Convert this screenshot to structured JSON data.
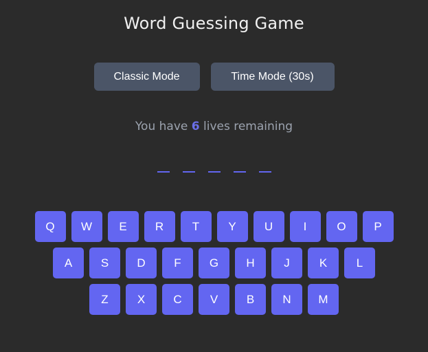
{
  "title": "Word Guessing Game",
  "modes": {
    "classic_label": "Classic Mode",
    "time_label": "Time Mode (30s)"
  },
  "lives": {
    "prefix": "You have",
    "count": "6",
    "suffix": "lives remaining"
  },
  "word": {
    "slots": [
      "_",
      "_",
      "_",
      "_",
      "_"
    ]
  },
  "keyboard": {
    "rows": [
      [
        "Q",
        "W",
        "E",
        "R",
        "T",
        "Y",
        "U",
        "I",
        "O",
        "P"
      ],
      [
        "A",
        "S",
        "D",
        "F",
        "G",
        "H",
        "J",
        "K",
        "L"
      ],
      [
        "Z",
        "X",
        "C",
        "V",
        "B",
        "N",
        "M"
      ]
    ]
  },
  "colors": {
    "background": "#2b2b2b",
    "key": "#6366f1",
    "mode_button": "#4b5567",
    "lives_count": "#6b6fe8"
  }
}
